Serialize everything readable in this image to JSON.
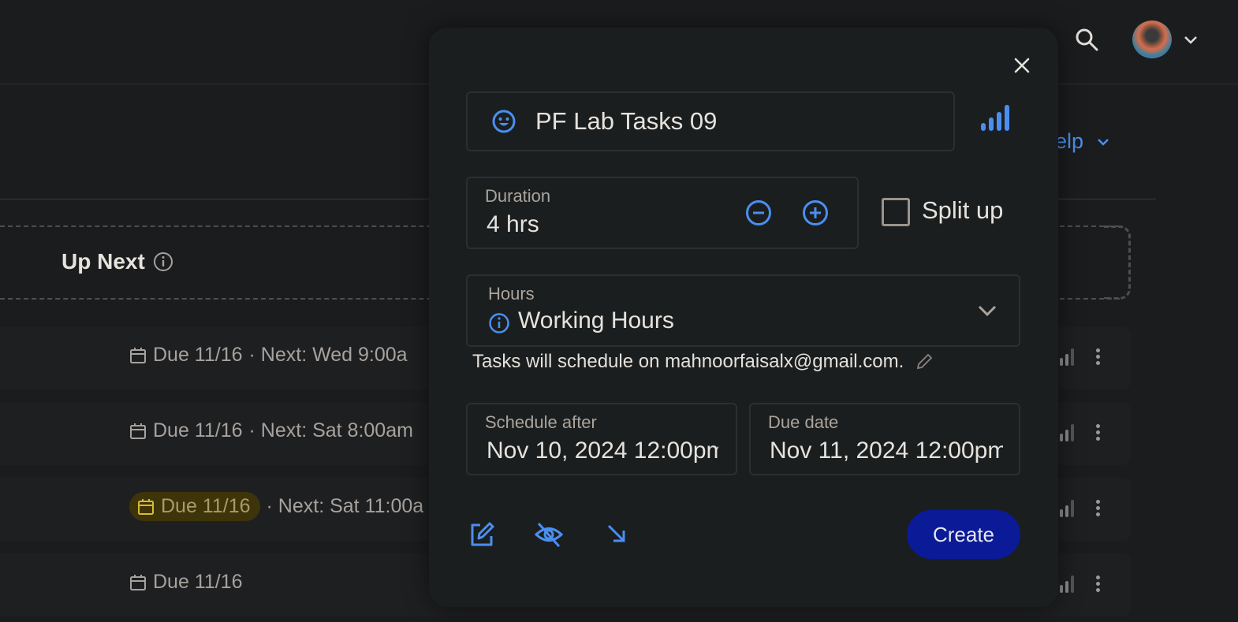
{
  "header": {
    "search_icon": "search-icon",
    "avatar": "user-avatar",
    "help_label": "elp"
  },
  "section": {
    "title": "Up Next"
  },
  "tasks": [
    {
      "due": "Due 11/16",
      "next": "· Next: Wed 9:00a",
      "highlight": false
    },
    {
      "due": "Due 11/16",
      "next": "· Next: Sat 8:00am",
      "highlight": false
    },
    {
      "due": "Due 11/16",
      "next": "· Next: Sat 11:00a",
      "highlight": true
    },
    {
      "due": "Due 11/16",
      "next": "",
      "highlight": false
    }
  ],
  "modal": {
    "task_name": "PF Lab Tasks 09",
    "duration": {
      "label": "Duration",
      "value": "4 hrs"
    },
    "split_up": {
      "label": "Split up",
      "checked": false
    },
    "hours": {
      "label": "Hours",
      "value": "Working Hours"
    },
    "schedule_note": "Tasks will schedule on mahnoorfaisalx@gmail.com.",
    "schedule_after": {
      "label": "Schedule after",
      "value": "Nov 10, 2024 12:00pm"
    },
    "due_date": {
      "label": "Due date",
      "value": "Nov 11, 2024 12:00pm"
    },
    "create_label": "Create"
  },
  "colors": {
    "accent": "#4a8ff0",
    "create_button": "#0b1a96",
    "due_highlight": "#3e3409",
    "background": "#1b1c1e"
  }
}
